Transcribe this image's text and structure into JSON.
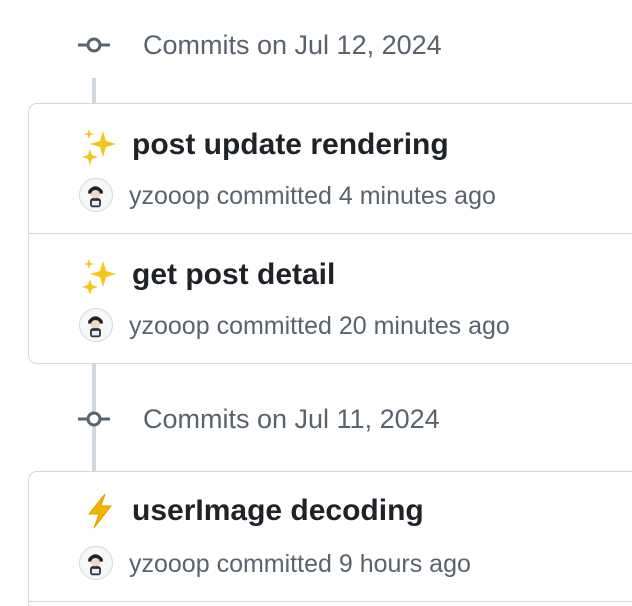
{
  "groups": [
    {
      "title": "Commits on Jul 12, 2024",
      "commits": [
        {
          "emoji": "sparkles-icon",
          "title": "post update rendering",
          "author": "yzooop",
          "verb": "committed",
          "time": "4 minutes ago"
        },
        {
          "emoji": "sparkles-icon",
          "title": "get post detail",
          "author": "yzooop",
          "verb": "committed",
          "time": "20 minutes ago"
        }
      ]
    },
    {
      "title": "Commits on Jul 11, 2024",
      "commits": [
        {
          "emoji": "zap-icon",
          "title": "userImage decoding",
          "author": "yzooop",
          "verb": "committed",
          "time": "9 hours ago"
        }
      ]
    }
  ],
  "colors": {
    "line": "#d0d7de",
    "muted": "#59636e",
    "title": "#1f2328",
    "sparkle": "#f5c518",
    "zap": "#f5b400"
  }
}
